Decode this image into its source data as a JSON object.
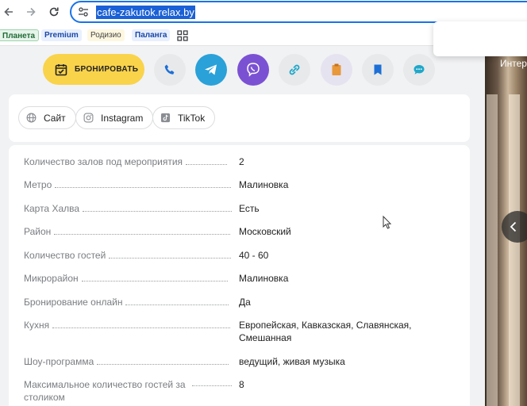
{
  "browser": {
    "url": "cafe-zakutok.relax.by",
    "bookmarks": [
      "Планета",
      "Premium",
      "Родизио",
      "Паланга"
    ]
  },
  "actions": {
    "book_label": "БРОНИРОВАТЬ",
    "icons": [
      "phone-icon",
      "telegram-icon",
      "viber-icon",
      "link-icon",
      "bag-icon",
      "bookmark-icon",
      "chat-icon"
    ],
    "colors": {
      "book": "#f9d34a",
      "telegram": "#2aa1d8",
      "viber": "#7b51d3"
    }
  },
  "social": [
    {
      "label": "Сайт",
      "icon": "globe-icon"
    },
    {
      "label": "Instagram",
      "icon": "instagram-icon"
    },
    {
      "label": "TikTok",
      "icon": "tiktok-icon"
    }
  ],
  "details": [
    {
      "label": "Количество залов под мероприятия",
      "value": "2"
    },
    {
      "label": "Метро",
      "value": "Малиновка"
    },
    {
      "label": "Карта Халва",
      "value": "Есть"
    },
    {
      "label": "Район",
      "value": "Московский"
    },
    {
      "label": "Количество гостей",
      "value": "40 - 60"
    },
    {
      "label": "Микрорайон",
      "value": "Малиновка"
    },
    {
      "label": "Бронирование онлайн",
      "value": "Да"
    },
    {
      "label": "Кухня",
      "value": "Европейская, Кавказская, Славянская, Смешанная"
    },
    {
      "label": "Шоу-программа",
      "value": "ведущий, живая музыка"
    },
    {
      "label": "Максимальное количество гостей за столиком",
      "value": "8"
    }
  ],
  "photo": {
    "label": "Интер"
  }
}
